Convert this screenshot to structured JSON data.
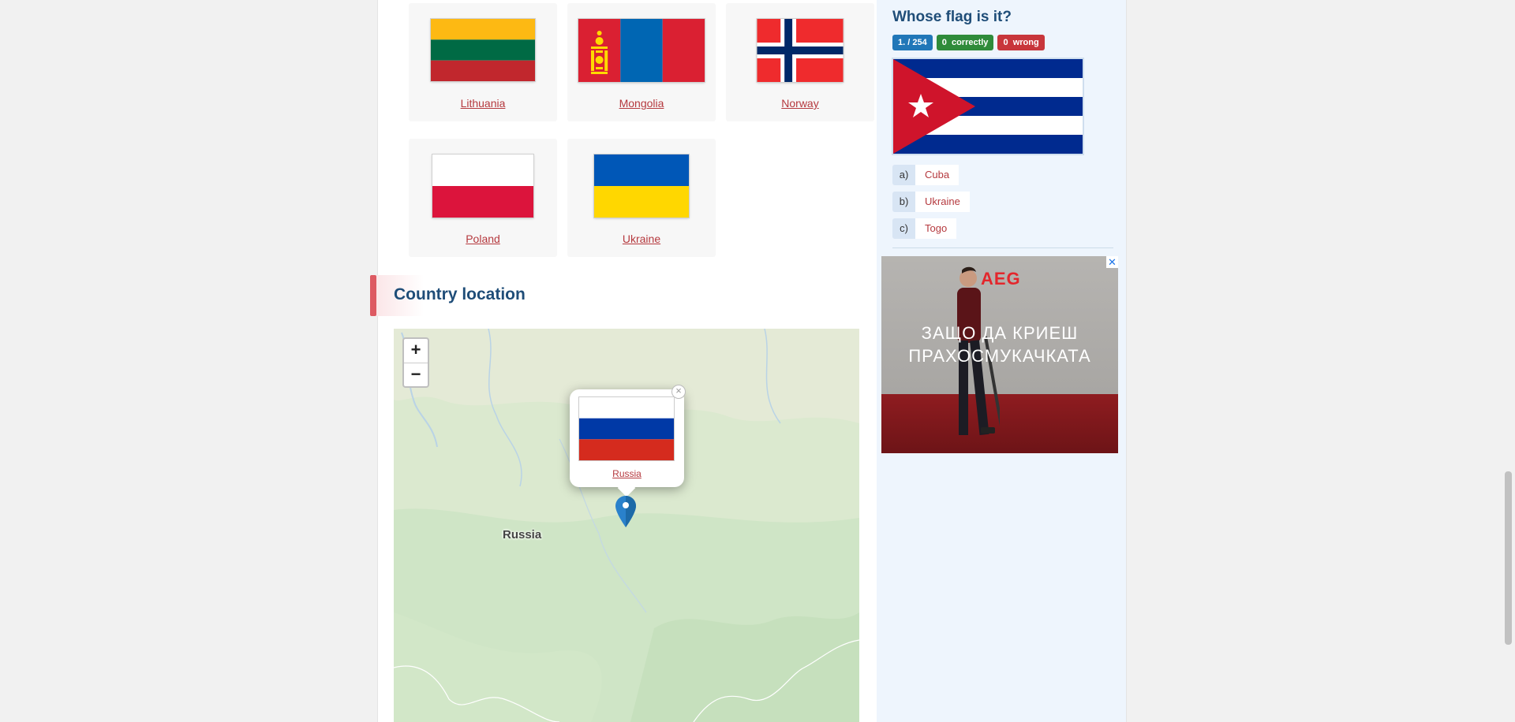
{
  "flags": [
    {
      "name": "Lithuania"
    },
    {
      "name": "Mongolia"
    },
    {
      "name": "Norway"
    },
    {
      "name": "Poland"
    },
    {
      "name": "Ukraine"
    }
  ],
  "section": {
    "title": "Country location"
  },
  "map": {
    "zoom_in": "+",
    "zoom_out": "−",
    "country_label": "Russia",
    "popup": {
      "link": "Russia",
      "close": "×"
    }
  },
  "quiz": {
    "title": "Whose flag is it?",
    "progress": "1. / 254",
    "correct_count": "0",
    "correct_label": "correctly",
    "wrong_count": "0",
    "wrong_label": "wrong",
    "answers": [
      {
        "letter": "a)",
        "text": "Cuba"
      },
      {
        "letter": "b)",
        "text": "Ukraine"
      },
      {
        "letter": "c)",
        "text": "Togo"
      }
    ]
  },
  "ad": {
    "brand": "AEG",
    "slogan_line1": "ЗАЩО ДА КРИЕШ",
    "slogan_line2": "ПРАХОСМУКАЧКАТА",
    "close": "✕"
  },
  "colors": {
    "link": "#b5393e",
    "heading": "#1f4d78",
    "accent": "#dd5a62",
    "sidebar_bg": "#eef5fd"
  }
}
